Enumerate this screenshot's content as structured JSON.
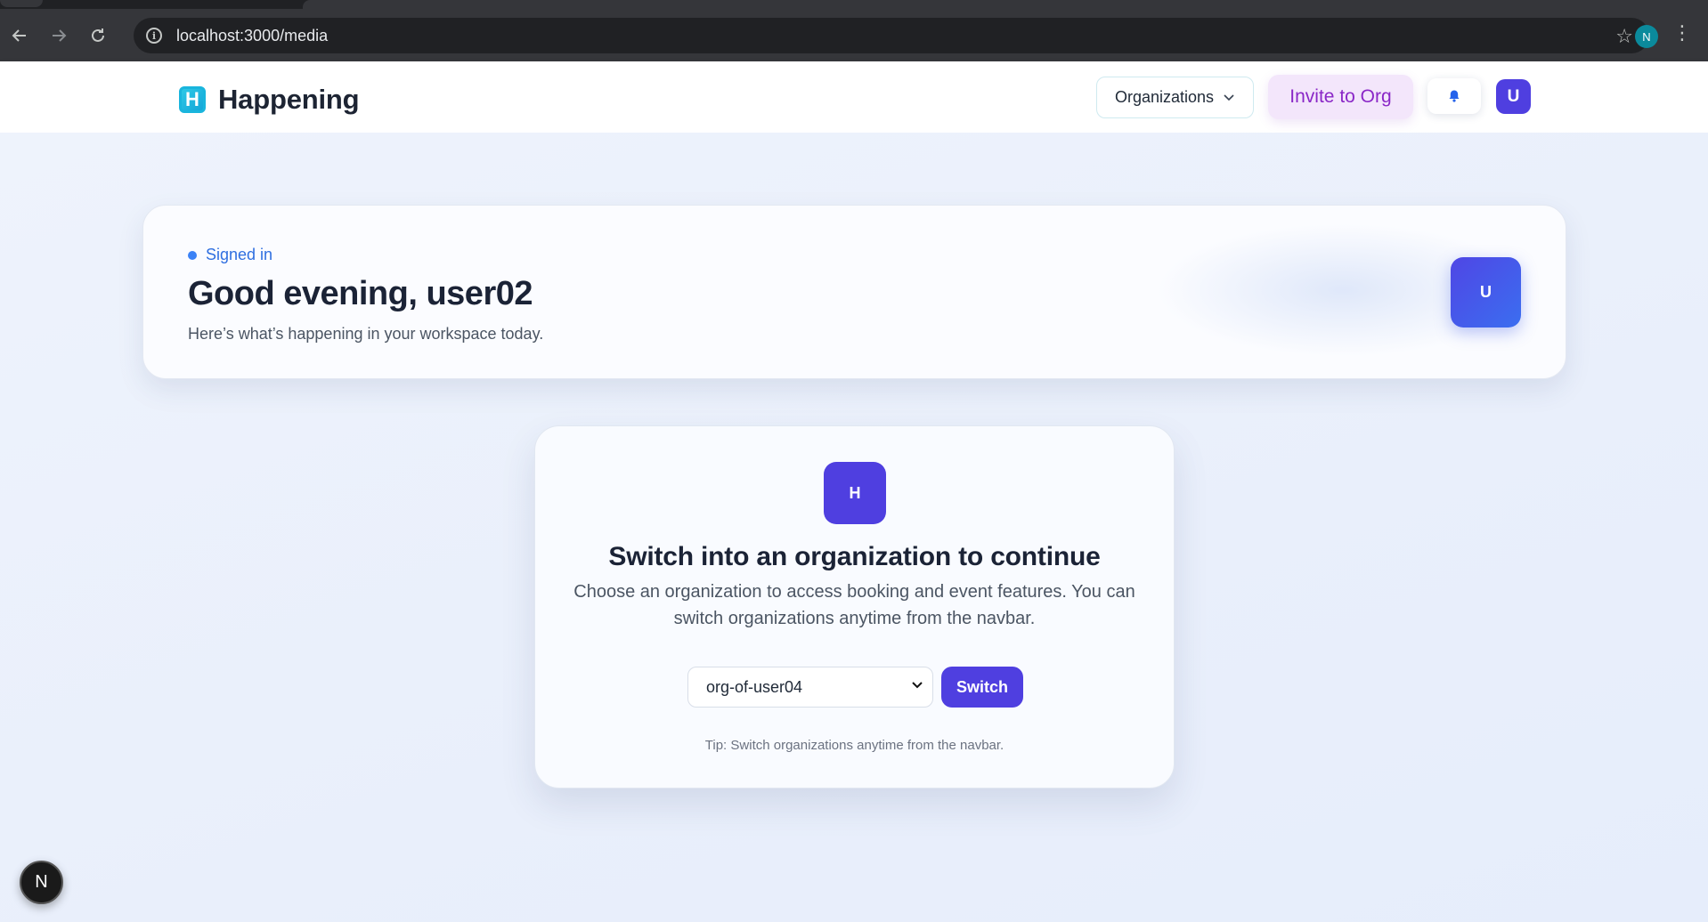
{
  "browser": {
    "url": "localhost:3000/media",
    "profile_initial": "N",
    "icons": {
      "back": "back-arrow-icon",
      "forward": "forward-arrow-icon",
      "reload": "reload-icon",
      "info": "info-icon",
      "star": "star-icon",
      "menu": "menu-dots-icon"
    }
  },
  "navbar": {
    "brand_logo_letter": "H",
    "brand_name": "Happening",
    "organizations_label": "Organizations",
    "invite_label": "Invite to Org",
    "avatar_initial": "U"
  },
  "welcome": {
    "status": "Signed in",
    "greeting": "Good evening, user02",
    "subtitle": "Here’s what’s happening in your workspace today.",
    "avatar_initial": "U"
  },
  "switch_card": {
    "badge_letter": "H",
    "title": "Switch into an organization to continue",
    "description": "Choose an organization to access booking and event features. You can switch organizations anytime from the navbar.",
    "selected_org": "org-of-user04",
    "switch_label": "Switch",
    "tip": "Tip: Switch organizations anytime from the navbar."
  },
  "dev_indicator": "N",
  "colors": {
    "accent": "#4f3fe0",
    "brand_logo": "#19b5dd",
    "invite_bg": "#f3e6fb",
    "invite_text": "#8a27c7",
    "signed_in": "#2f6fe0"
  }
}
